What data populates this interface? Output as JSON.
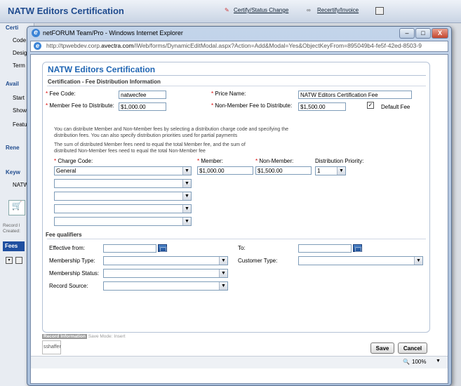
{
  "background": {
    "title": "NATW Editors Certification",
    "links": [
      "Certify/Status Change",
      "Recertify/Invoice"
    ],
    "sidebar": [
      "Certi",
      "Code",
      "Desig",
      "Term",
      "Avail",
      "Start",
      "Show",
      "Featu",
      "Rene",
      "Keyw",
      "NATW",
      "Record I",
      "Created:",
      "Fees"
    ]
  },
  "window": {
    "title": "netFORUM Team/Pro - Windows Internet Explorer",
    "url_prefix": "http://tpwebdev.corp.",
    "url_domain": "avectra.com",
    "url_rest": "/iWeb/forms/DynamicEditModal.aspx?Action=Add&Modal=Yes&ObjectKeyFrom=895049b4-fe5f-42ed-8503-9",
    "minimize": "–",
    "maximize": "□",
    "close": "X"
  },
  "form": {
    "title": "NATW Editors Certification",
    "section": "Certification - Fee Distribution Information",
    "fee_code_label": "Fee Code:",
    "fee_code": "natwecfee",
    "price_name_label": "Price Name:",
    "price_name": "NATW Editors Certification Fee",
    "member_fee_label": "Member Fee to Distribute:",
    "member_fee": "$1,000.00",
    "nonmember_fee_label": "Non-Member Fee to Distribute:",
    "nonmember_fee": "$1,500.00",
    "default_fee_label": "Default Fee",
    "default_fee_check": "✓",
    "help1": "You can distribute Member and Non-Member fees by selecting a distribution charge code and specifying the distribution fees. You can also specify distribution priorities used for partial payments",
    "help2": "The sum of distributed Member fees need to equal the total Member fee, and the sum of distributed Non-Member fees need to equal the total Non-Member fee",
    "charge_code_label": "Charge Code:",
    "member_label": "Member:",
    "nonmember_label": "Non-Member:",
    "priority_label": "Distribution Priority:",
    "charge_code": "General",
    "member_amount": "$1,000.00",
    "nonmember_amount": "$1,500.00",
    "priority": "1",
    "fee_qualifiers": "Fee qualifiers",
    "effective_from_label": "Effective from:",
    "to_label": "To:",
    "membership_type_label": "Membership Type:",
    "customer_type_label": "Customer Type:",
    "membership_status_label": "Membership Status:",
    "record_source_label": "Record Source:"
  },
  "footer": {
    "record_info": "Record Information",
    "save_mode": "Save Mode: Insert",
    "user": "sshaffer",
    "save": "Save",
    "cancel": "Cancel",
    "zoom": "100%"
  },
  "colors": {
    "accent": "#1f65b3",
    "required": "#dd0000"
  }
}
